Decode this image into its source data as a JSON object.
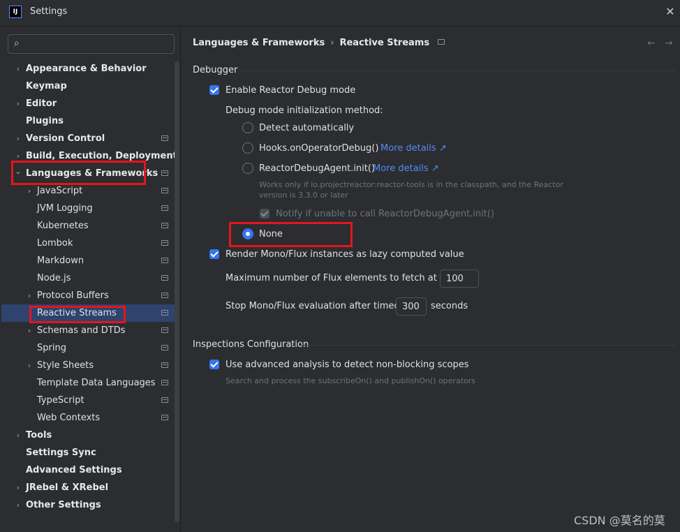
{
  "window": {
    "app_logo": "IJ",
    "title": "Settings",
    "close_glyph": "✕"
  },
  "search": {
    "placeholder": "",
    "value": "",
    "icon": "search-icon"
  },
  "sidebar": {
    "items": [
      {
        "label": "Appearance & Behavior",
        "level": 0,
        "bold": true,
        "expandable": true,
        "expanded": false,
        "pinned": false,
        "selected": false
      },
      {
        "label": "Keymap",
        "level": 0,
        "bold": true,
        "expandable": false,
        "pinned": false,
        "selected": false
      },
      {
        "label": "Editor",
        "level": 0,
        "bold": true,
        "expandable": true,
        "expanded": false,
        "pinned": false,
        "selected": false
      },
      {
        "label": "Plugins",
        "level": 0,
        "bold": true,
        "expandable": false,
        "pinned": false,
        "selected": false
      },
      {
        "label": "Version Control",
        "level": 0,
        "bold": true,
        "expandable": true,
        "expanded": false,
        "pinned": true,
        "selected": false
      },
      {
        "label": "Build, Execution, Deployment",
        "level": 0,
        "bold": true,
        "expandable": true,
        "expanded": false,
        "pinned": false,
        "selected": false
      },
      {
        "label": "Languages & Frameworks",
        "level": 0,
        "bold": true,
        "expandable": true,
        "expanded": true,
        "pinned": true,
        "selected": false
      },
      {
        "label": "JavaScript",
        "level": 1,
        "bold": false,
        "expandable": true,
        "expanded": false,
        "pinned": true,
        "selected": false
      },
      {
        "label": "JVM Logging",
        "level": 1,
        "bold": false,
        "expandable": false,
        "pinned": true,
        "selected": false
      },
      {
        "label": "Kubernetes",
        "level": 1,
        "bold": false,
        "expandable": false,
        "pinned": true,
        "selected": false
      },
      {
        "label": "Lombok",
        "level": 1,
        "bold": false,
        "expandable": false,
        "pinned": true,
        "selected": false
      },
      {
        "label": "Markdown",
        "level": 1,
        "bold": false,
        "expandable": false,
        "pinned": true,
        "selected": false
      },
      {
        "label": "Node.js",
        "level": 1,
        "bold": false,
        "expandable": false,
        "pinned": true,
        "selected": false
      },
      {
        "label": "Protocol Buffers",
        "level": 1,
        "bold": false,
        "expandable": true,
        "expanded": false,
        "pinned": true,
        "selected": false
      },
      {
        "label": "Reactive Streams",
        "level": 1,
        "bold": false,
        "expandable": false,
        "pinned": true,
        "selected": true
      },
      {
        "label": "Schemas and DTDs",
        "level": 1,
        "bold": false,
        "expandable": true,
        "expanded": false,
        "pinned": true,
        "selected": false
      },
      {
        "label": "Spring",
        "level": 1,
        "bold": false,
        "expandable": false,
        "pinned": true,
        "selected": false
      },
      {
        "label": "Style Sheets",
        "level": 1,
        "bold": false,
        "expandable": true,
        "expanded": false,
        "pinned": true,
        "selected": false
      },
      {
        "label": "Template Data Languages",
        "level": 1,
        "bold": false,
        "expandable": false,
        "pinned": true,
        "selected": false
      },
      {
        "label": "TypeScript",
        "level": 1,
        "bold": false,
        "expandable": false,
        "pinned": true,
        "selected": false
      },
      {
        "label": "Web Contexts",
        "level": 1,
        "bold": false,
        "expandable": false,
        "pinned": true,
        "selected": false
      },
      {
        "label": "Tools",
        "level": 0,
        "bold": true,
        "expandable": true,
        "expanded": false,
        "pinned": false,
        "selected": false
      },
      {
        "label": "Settings Sync",
        "level": 0,
        "bold": true,
        "expandable": false,
        "pinned": false,
        "selected": false
      },
      {
        "label": "Advanced Settings",
        "level": 0,
        "bold": true,
        "expandable": false,
        "pinned": false,
        "selected": false
      },
      {
        "label": "JRebel & XRebel",
        "level": 0,
        "bold": true,
        "expandable": true,
        "expanded": false,
        "pinned": false,
        "selected": false
      },
      {
        "label": "Other Settings",
        "level": 0,
        "bold": true,
        "expandable": true,
        "expanded": false,
        "pinned": false,
        "selected": false
      }
    ]
  },
  "breadcrumb": {
    "parent": "Languages & Frameworks",
    "separator": "›",
    "current": "Reactive Streams"
  },
  "nav": {
    "back_glyph": "←",
    "forward_glyph": "→"
  },
  "debugger": {
    "title": "Debugger",
    "enable_label": "Enable Reactor Debug mode",
    "enable_checked": true,
    "method_label": "Debug mode initialization method:",
    "options": {
      "detect": "Detect automatically",
      "hooks": "Hooks.onOperatorDebug()",
      "agent": "ReactorDebugAgent.init()",
      "none": "None"
    },
    "selected_option": "None",
    "more_details": "More details",
    "external_glyph": "↗",
    "agent_hint_line1": "Works only if io.projectreactor:reactor-tools is in the classpath, and the Reactor",
    "agent_hint_line2": "version is 3.3.0 or later",
    "notify_label": "Notify if unable to call ReactorDebugAgent.init()",
    "notify_checked": true,
    "render_label": "Render Mono/Flux instances as lazy computed value",
    "render_checked": true,
    "max_flux_label": "Maximum number of Flux elements to fetch at once:",
    "max_flux_value": "100",
    "timeout_label": "Stop Mono/Flux evaluation after timeout:",
    "timeout_value": "300",
    "timeout_unit": "seconds"
  },
  "inspections": {
    "title": "Inspections Configuration",
    "advanced_label": "Use advanced analysis to detect non-blocking scopes",
    "advanced_checked": true,
    "advanced_hint": "Search and process the subscribeOn() and publishOn() operators"
  },
  "watermark": "CSDN @莫名的莫",
  "annotation_color": "#e8141b",
  "accent_color": "#3574f0"
}
